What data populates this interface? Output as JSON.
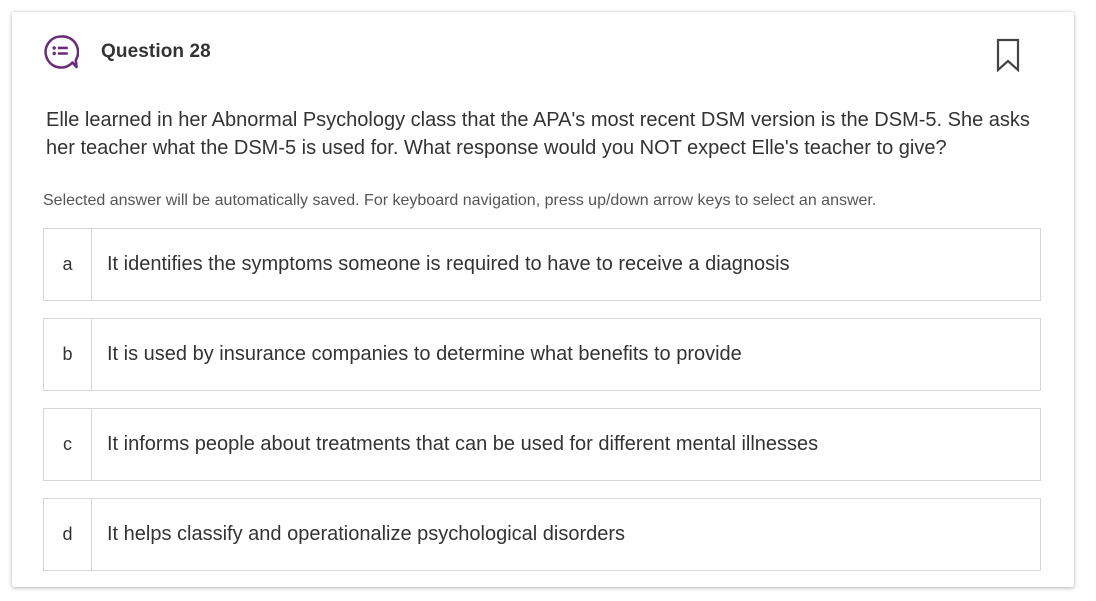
{
  "question": {
    "title": "Question 28",
    "icon": "question-list-icon",
    "stem": "Elle learned in her Abnormal Psychology class that the APA's most recent DSM version is the DSM-5. She asks her teacher what the DSM-5 is used for. What response would you NOT expect Elle's teacher to give?",
    "hint": "Selected answer will be automatically saved. For keyboard navigation, press up/down arrow keys to select an answer.",
    "options": [
      {
        "letter": "a",
        "text": "It identifies the symptoms someone is required to have to receive a diagnosis"
      },
      {
        "letter": "b",
        "text": "It is used by insurance companies to determine what benefits to provide"
      },
      {
        "letter": "c",
        "text": "It informs people about treatments that can be used for different mental illnesses"
      },
      {
        "letter": "d",
        "text": "It helps classify and operationalize psychological disorders"
      }
    ]
  },
  "bookmark": {
    "icon": "bookmark-icon"
  },
  "colors": {
    "accent": "#6b2c7a",
    "text": "#333333",
    "border": "#d6d6d6"
  }
}
